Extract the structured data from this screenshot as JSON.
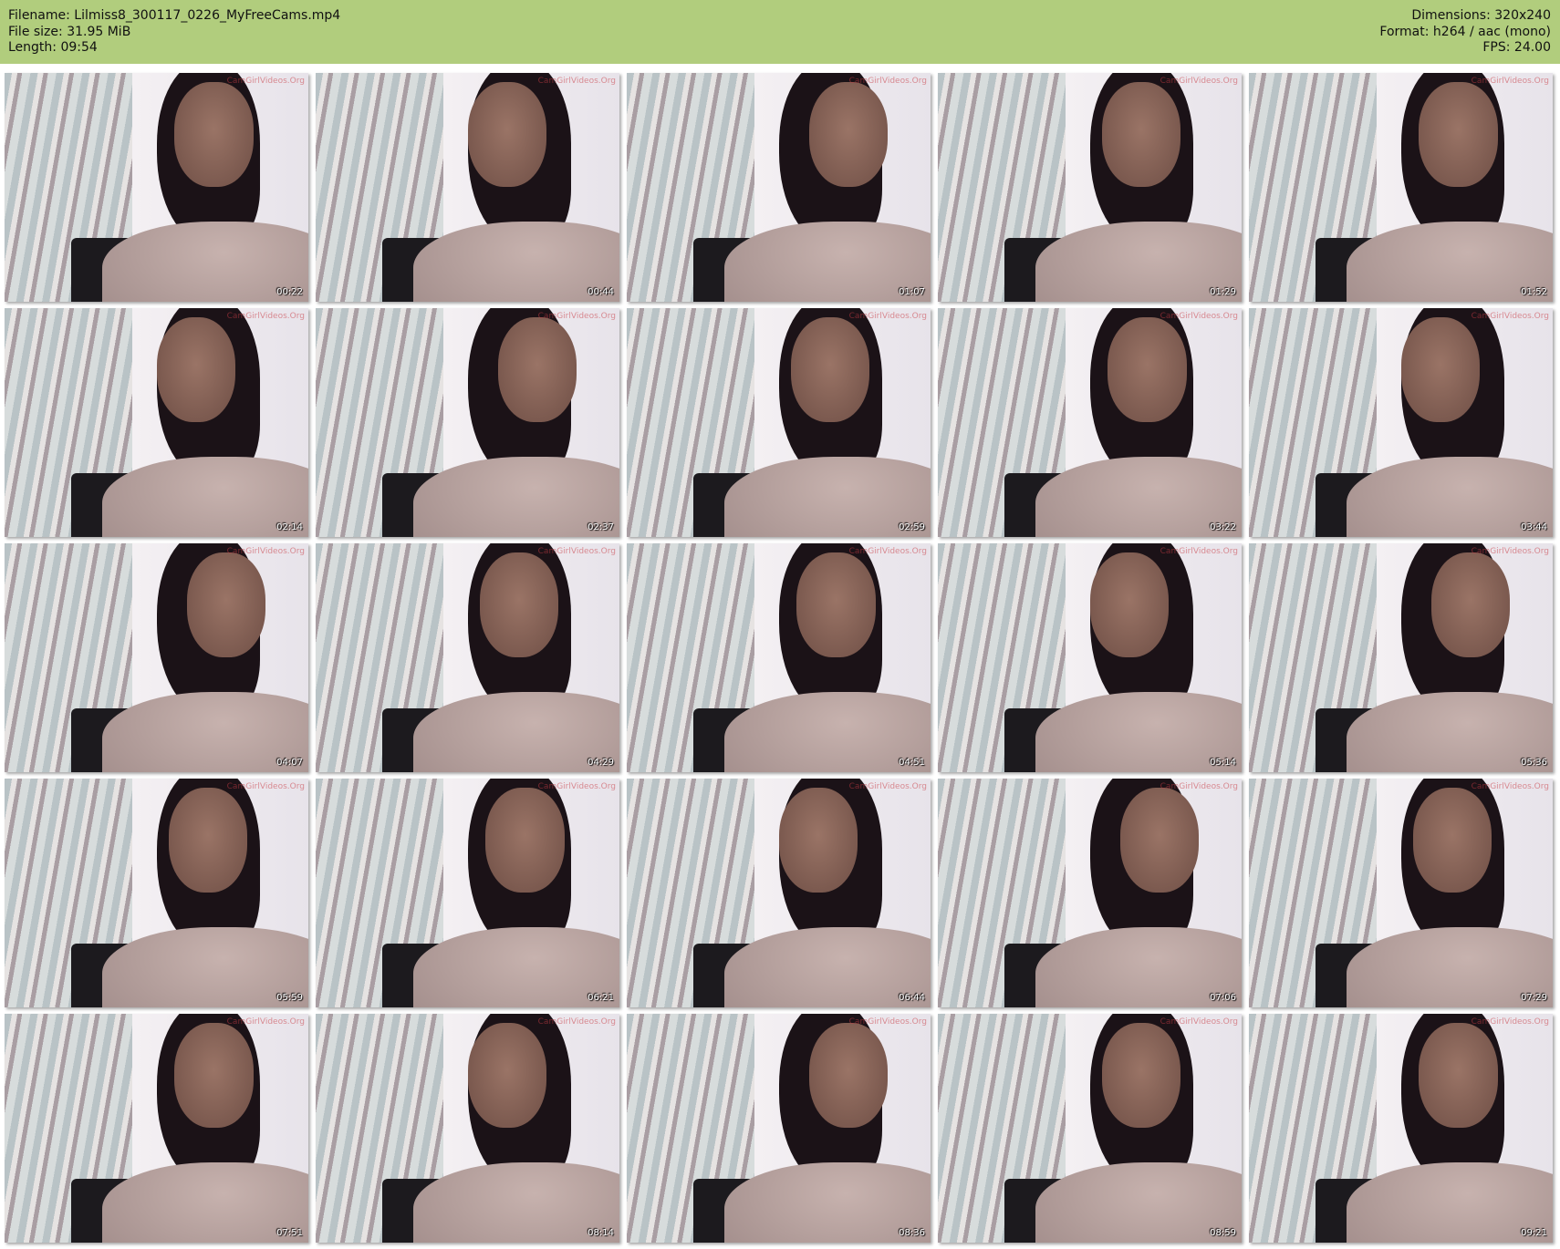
{
  "header": {
    "filename": "Filename: Lilmiss8_300117_0226_MyFreeCams.mp4",
    "filesize": "File size: 31.95 MiB",
    "length": "Length: 09:54",
    "dimensions": "Dimensions: 320x240",
    "format": "Format: h264 / aac (mono)",
    "fps": "FPS: 24.00"
  },
  "thumbnails": [
    "00:22",
    "00:44",
    "01:07",
    "01:29",
    "01:52",
    "02:14",
    "02:37",
    "02:59",
    "03:22",
    "03:44",
    "04:07",
    "04:29",
    "04:51",
    "05:14",
    "05:36",
    "05:59",
    "06:21",
    "06:44",
    "07:06",
    "07:29",
    "07:51",
    "08:14",
    "08:36",
    "08:59",
    "09:21"
  ],
  "watermark": "CamGirlVideos.Org"
}
